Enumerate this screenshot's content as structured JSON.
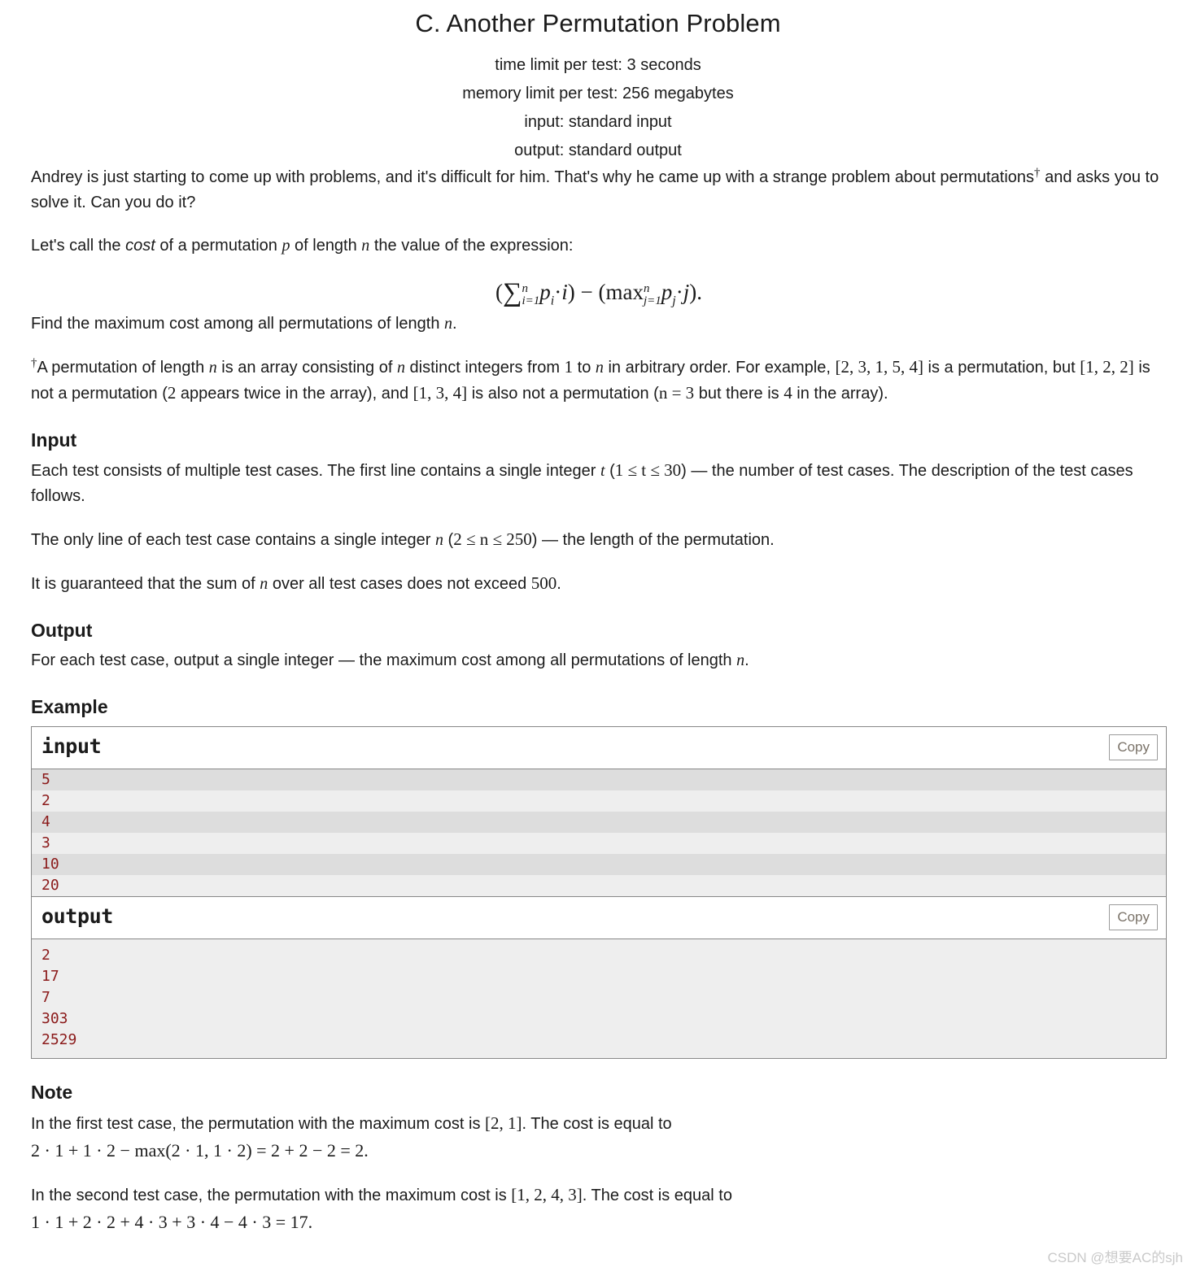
{
  "header": {
    "title": "C. Another Permutation Problem",
    "limits": [
      "time limit per test: 3 seconds",
      "memory limit per test: 256 megabytes",
      "input: standard input",
      "output: standard output"
    ]
  },
  "legend": {
    "p1_a": "Andrey is just starting to come up with problems, and it's difficult for him. That's why he came up with a strange problem about permutations",
    "p1_dagger": "†",
    "p1_b": " and asks you to solve it. Can you do it?",
    "p2_a": "Let's call the ",
    "p2_cost": "cost",
    "p2_b": " of a permutation ",
    "p2_p": "p",
    "p2_c": " of length ",
    "p2_n": "n",
    "p2_d": " the value of the expression:",
    "formula": "(∑ⁿ i=1 pᵢ · i) − (maxⁿ j=1 pⱼ · j).",
    "formula_parts": {
      "open": "(",
      "sum": "∑",
      "sum_upper": "n",
      "sum_lower": "i=1",
      "term1": "p",
      "term1_sub": "i",
      "dot1": "·",
      "idx1": "i",
      "close": ")",
      "minus": "−",
      "open2": "(",
      "max": "max",
      "max_upper": "n",
      "max_lower": "j=1",
      "term2": "p",
      "term2_sub": "j",
      "dot2": "·",
      "idx2": "j",
      "close2": ")",
      "period": "."
    },
    "p3_a": "Find the maximum cost among all permutations of length ",
    "p3_n": "n",
    "p3_b": "."
  },
  "footnote": {
    "dagger": "†",
    "t1": "A permutation of length ",
    "n1": "n",
    "t2": " is an array consisting of ",
    "n2": "n",
    "t3": " distinct integers from ",
    "one": "1",
    "t4": " to ",
    "n3": "n",
    "t5": " in arbitrary order. For example, ",
    "arr1": "[2, 3, 1, 5, 4]",
    "t6": " is a permutation, but ",
    "arr2": "[1, 2, 2]",
    "t7": " is not a permutation (",
    "two": "2",
    "t8": " appears twice in the array), and ",
    "arr3": "[1, 3, 4]",
    "t9": " is also not a permutation (",
    "neq3": "n = 3",
    "t10": " but there is ",
    "four": "4",
    "t11": " in the array)."
  },
  "input_section": {
    "title": "Input",
    "p1_a": "Each test consists of multiple test cases. The first line contains a single integer ",
    "p1_t": "t",
    "p1_b": " (",
    "p1_range": "1 ≤ t ≤ 30",
    "p1_c": ") — the number of test cases. The description of the test cases follows.",
    "p2_a": "The only line of each test case contains a single integer ",
    "p2_n": "n",
    "p2_b": " (",
    "p2_range": "2 ≤ n ≤ 250",
    "p2_c": ") — the length of the permutation.",
    "p3_a": "It is guaranteed that the sum of ",
    "p3_n": "n",
    "p3_b": " over all test cases does not exceed ",
    "p3_500": "500",
    "p3_c": "."
  },
  "output_section": {
    "title": "Output",
    "p1_a": "For each test case, output a single integer — the maximum cost among all permutations of length ",
    "p1_n": "n",
    "p1_b": "."
  },
  "example_section": {
    "title": "Example",
    "copy_label": "Copy",
    "input": {
      "label": "input",
      "lines": [
        "5",
        "2",
        "4",
        "3",
        "10",
        "20"
      ]
    },
    "output": {
      "label": "output",
      "lines": [
        "2",
        "17",
        "7",
        "303",
        "2529"
      ]
    }
  },
  "note_section": {
    "title": "Note",
    "p1_a": "In the first test case, the permutation with the maximum cost is ",
    "p1_perm": "[2, 1]",
    "p1_b": ". The cost is equal to",
    "p1_math": "2 · 1 + 1 · 2 − max(2 · 1, 1 · 2) = 2 + 2 − 2 = 2.",
    "p2_a": "In the second test case, the permutation with the maximum cost is ",
    "p2_perm": "[1, 2, 4, 3]",
    "p2_b": ". The cost is equal to",
    "p2_math": "1 · 1 + 2 · 2 + 4 · 3 + 3 · 4 − 4 · 3 = 17."
  },
  "watermark": {
    "text": "CSDN @想要AC的sjh"
  },
  "colors": {
    "sample_text": "#8b1a1a",
    "stripe_dark": "#dddddd",
    "stripe_light": "#eeeeee",
    "border": "#888888",
    "copy_text": "#7a7268",
    "watermark": "#c9c9c9"
  }
}
